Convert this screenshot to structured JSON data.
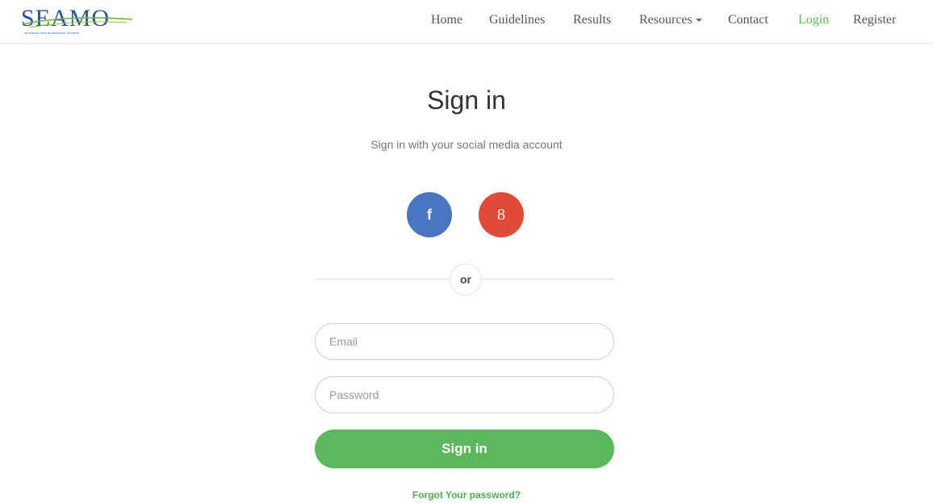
{
  "brand": {
    "logo_text": "SEAMO",
    "tagline": "SOUTHEAST ASIAN MATHEMATICAL OLYMPIAD",
    "accent_color": "#5cb85c",
    "logo_color": "#2a4f9a"
  },
  "nav": {
    "home": "Home",
    "guidelines": "Guidelines",
    "results": "Results",
    "resources": "Resources",
    "contact": "Contact",
    "login": "Login",
    "register": "Register",
    "active_item": "Login"
  },
  "signin": {
    "title": "Sign in",
    "subtitle": "Sign in with your social media account",
    "facebook_glyph": "f",
    "google_glyph": "8",
    "divider": "or",
    "email_placeholder": "Email",
    "password_placeholder": "Password",
    "submit_label": "Sign in",
    "forgot_label": "Forgot Your password?",
    "facebook_color": "#4a76c0",
    "google_color": "#e04a37"
  }
}
